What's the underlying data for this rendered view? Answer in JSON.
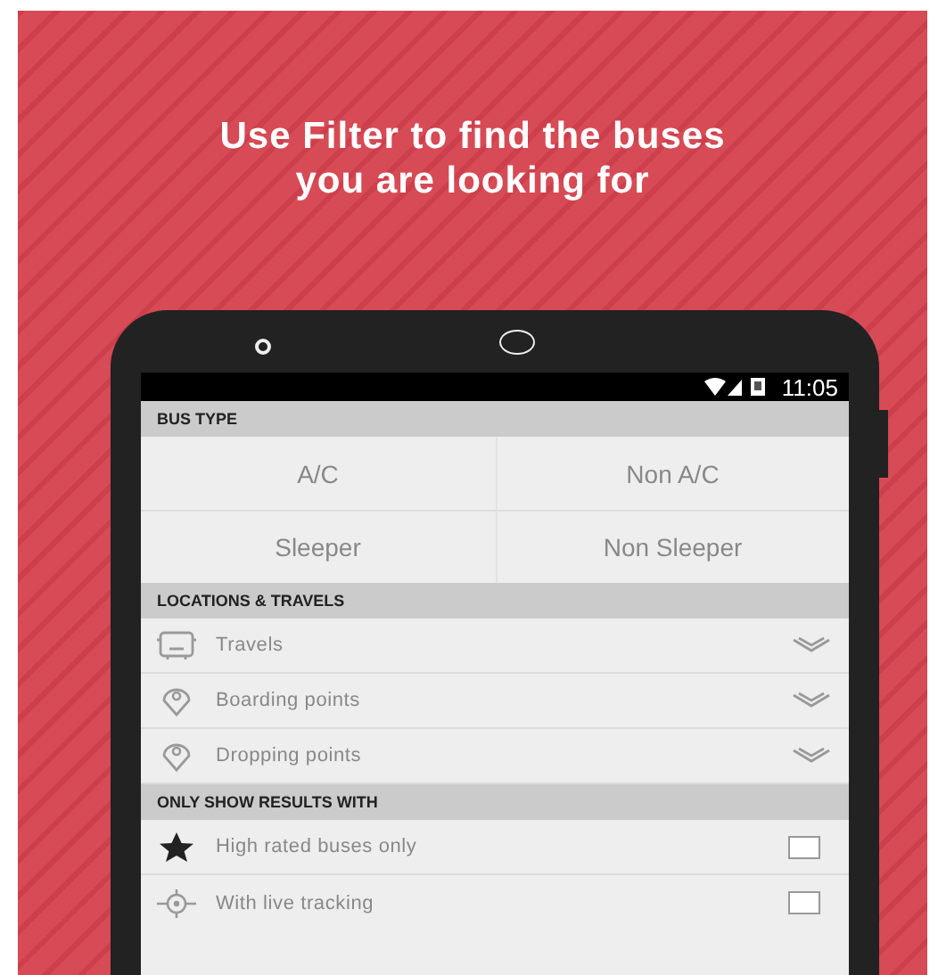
{
  "headline": [
    "Use Filter to find the buses",
    "you are looking for"
  ],
  "status_bar": {
    "time": "11:05"
  },
  "bus_type": {
    "header": "BUS TYPE",
    "options": [
      {
        "label": "A/C",
        "selected": false
      },
      {
        "label": "Non A/C",
        "selected": false
      },
      {
        "label": "Sleeper",
        "selected": false
      },
      {
        "label": "Non Sleeper",
        "selected": false
      }
    ]
  },
  "locations": {
    "header": "LOCATIONS & TRAVELS",
    "items": [
      {
        "label": "Travels"
      },
      {
        "label": "Boarding points"
      },
      {
        "label": "Dropping points"
      }
    ]
  },
  "only_show": {
    "header": "ONLY SHOW RESULTS WITH",
    "items": [
      {
        "label": "High rated buses only",
        "checked": false
      },
      {
        "label": "With live tracking",
        "checked": false
      }
    ]
  }
}
